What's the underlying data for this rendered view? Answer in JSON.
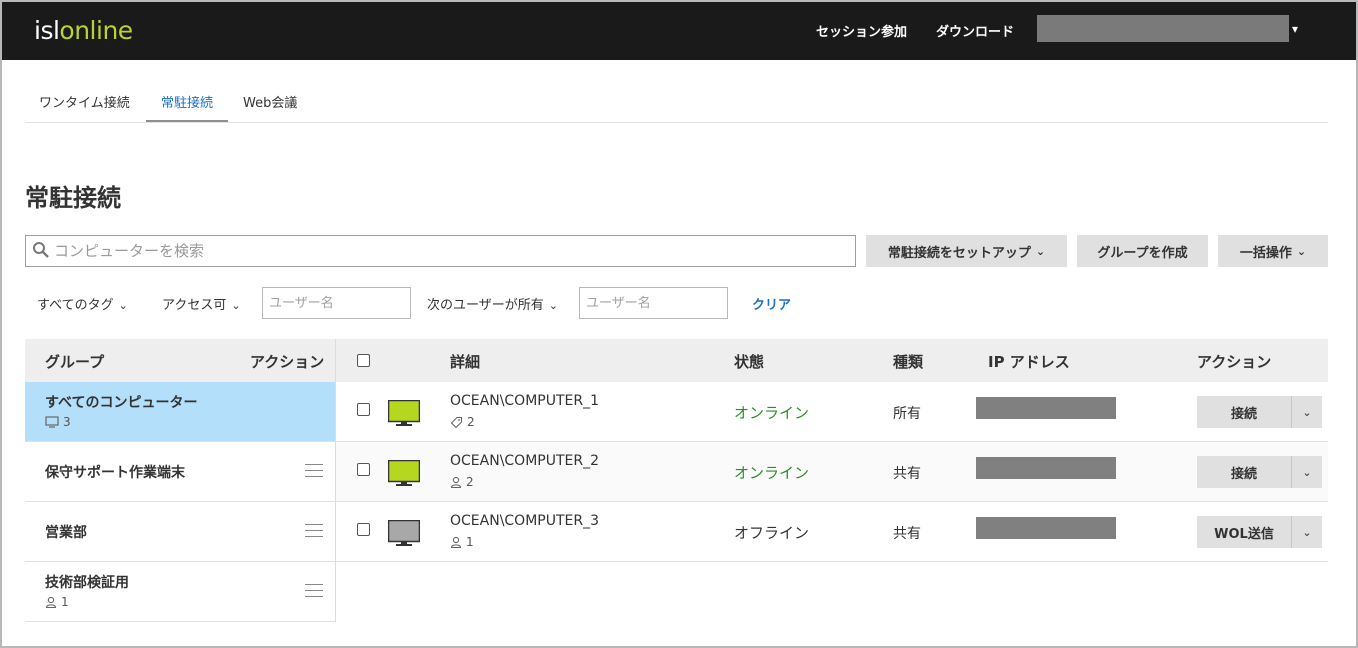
{
  "header": {
    "logo_isl": "isl",
    "logo_online": "online",
    "join_session": "セッション参加",
    "download": "ダウンロード",
    "user_chevron": "⌄"
  },
  "tabs": [
    {
      "label": "ワンタイム接続"
    },
    {
      "label": "常駐接続"
    },
    {
      "label": "Web会議"
    }
  ],
  "page_title": "常駐接続",
  "search": {
    "placeholder": "コンピューターを検索"
  },
  "buttons": {
    "setup": "常駐接続をセットアップ",
    "create_group": "グループを作成",
    "bulk": "一括操作"
  },
  "filters": {
    "all_tags": "すべてのタグ",
    "access": "アクセス可",
    "username_placeholder_1": "ユーザー名",
    "owned_by": "次のユーザーが所有",
    "username_placeholder_2": "ユーザー名",
    "clear": "クリア"
  },
  "group_panel": {
    "header_group": "グループ",
    "header_action": "アクション",
    "groups": [
      {
        "name": "すべてのコンピューター",
        "count": "3",
        "count_icon": "monitor-icon",
        "selected": true
      },
      {
        "name": "保守サポート作業端末",
        "count": "",
        "selected": false
      },
      {
        "name": "営業部",
        "count": "",
        "selected": false
      },
      {
        "name": "技術部検証用",
        "count": "1",
        "count_icon": "user-icon",
        "selected": false
      }
    ]
  },
  "table": {
    "headers": {
      "details": "詳細",
      "status": "状態",
      "kind": "種類",
      "ip": "IP アドレス",
      "action": "アクション"
    },
    "rows": [
      {
        "name": "OCEAN\\COMPUTER_1",
        "meta": "2",
        "meta_icon": "tag-icon",
        "status": "オンライン",
        "kind": "所有",
        "action": "接続",
        "online": true
      },
      {
        "name": "OCEAN\\COMPUTER_2",
        "meta": "2",
        "meta_icon": "user-icon",
        "status": "オンライン",
        "kind": "共有",
        "action": "接続",
        "online": true
      },
      {
        "name": "OCEAN\\COMPUTER_3",
        "meta": "1",
        "meta_icon": "user-icon",
        "status": "オフライン",
        "kind": "共有",
        "action": "WOL送信",
        "online": false
      }
    ]
  },
  "colors": {
    "online_text": "#2a8f2a",
    "offline_text": "#333333",
    "online_monitor": "#b5d81e",
    "offline_monitor": "#a8a8a8",
    "link": "#1e6fbf",
    "selected_group": "#b3dffa"
  }
}
